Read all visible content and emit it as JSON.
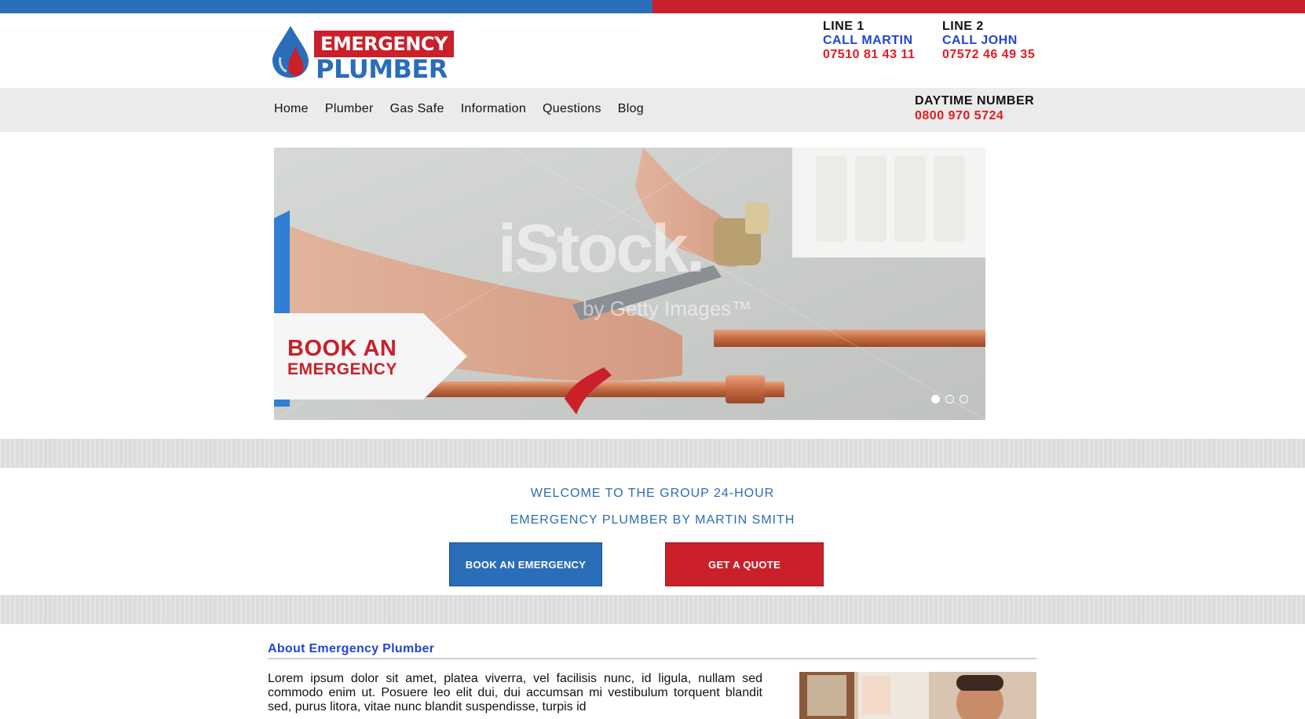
{
  "colors": {
    "brand_blue": "#2a6db8",
    "brand_red": "#c9202a",
    "nav_bg": "#ebebeb",
    "link_blue": "#2146d0",
    "phone_red": "#e21b22"
  },
  "logo": {
    "icon": "flame-drop-icon",
    "line1": "EMERGENCY",
    "line2": "PLUMBER"
  },
  "contacts": [
    {
      "line": "LINE 1",
      "name": "CALL MARTIN",
      "phone": "07510 81 43 11"
    },
    {
      "line": "LINE 2",
      "name": "CALL JOHN",
      "phone": "07572 46 49 35"
    }
  ],
  "nav": {
    "items": [
      "Home",
      "Plumber",
      "Gas Safe",
      "Information",
      "Questions",
      "Blog"
    ],
    "daytime_label": "DAYTIME NUMBER",
    "daytime_number": "0800 970 5724"
  },
  "hero": {
    "badge_line1": "BOOK AN",
    "badge_line2": "EMERGENCY",
    "watermark": "iStock.",
    "watermark_sub": "by Getty Images™",
    "slides": 3,
    "active_slide": 1
  },
  "welcome": {
    "line1": "WELCOME TO THE GROUP 24-HOUR",
    "line2": "EMERGENCY PLUMBER BY MARTIN SMITH",
    "book_label": "BOOK AN EMERGENCY",
    "quote_label": "GET A QUOTE"
  },
  "about": {
    "title": "About Emergency Plumber",
    "text": "Lorem ipsum dolor sit amet, platea viverra, vel facilisis nunc, id ligula, nullam sed commodo enim ut. Posuere leo elit dui, dui accumsan mi vestibulum torquent blandit sed, purus litora, vitae nunc blandit suspendisse, turpis id"
  }
}
